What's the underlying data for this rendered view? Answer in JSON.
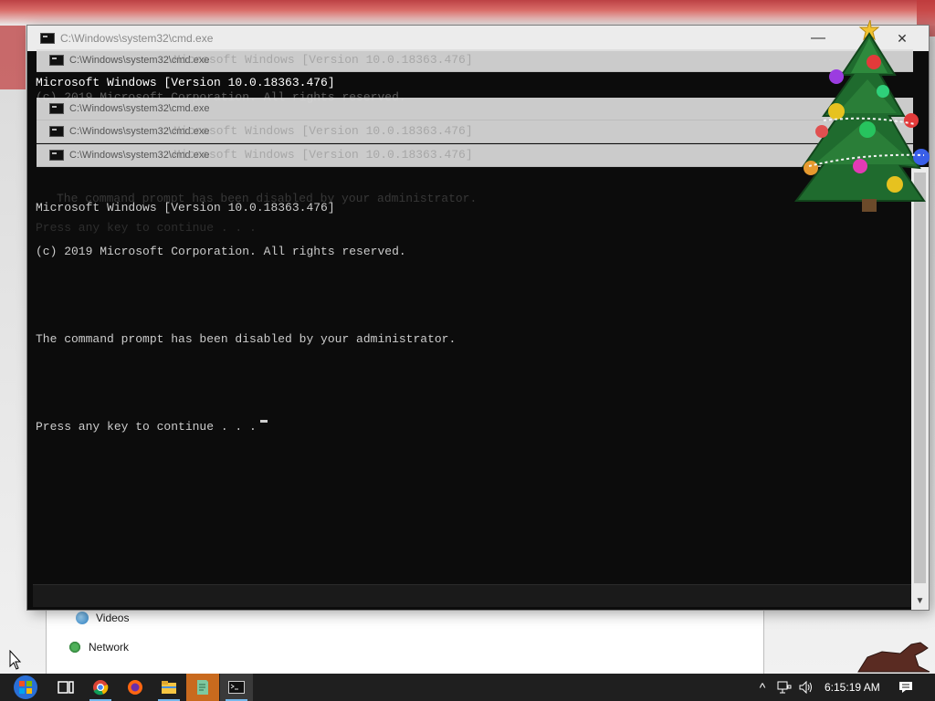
{
  "cmd_window": {
    "title": "C:\\Windows\\system32\\cmd.exe",
    "minimize_label": "—",
    "close_label": "✕",
    "ghost_titles": [
      "C:\\Windows\\system32\\cmd.exe",
      "C:\\Windows\\system32\\cmd.exe",
      "C:\\Windows\\system32\\cmd.exe",
      "C:\\Windows\\system32\\cmd.exe"
    ],
    "ghost_lines": [
      "Microsoft Windows [Version 10.0.18363.476]",
      "(c) 2019 Microsoft Corporation. All rights reserved.",
      "Microsoft Windows [Version 10.0.18363.476]",
      "Microsoft Windows [Version 10.0.18363.476]",
      "(c) 2019 Microsoft Corporation. All rights reserved."
    ],
    "console_lines": [
      "Microsoft Windows [Version 10.0.18363.476]",
      "(c) 2019 Microsoft Corporation. All rights reserved.",
      "",
      "The command prompt has been disabled by your administrator.",
      "",
      "Press any key to continue . . ."
    ],
    "console_top_line": "Microsoft Windows [Version 10.0.18363.476]",
    "console_top_line2": "(c) 2019 Microsoft Corporation. All rights reserved.",
    "faint_line_1": "The command prompt has been disabled by your administrator.",
    "faint_line_2": "Press any key to continue . . ."
  },
  "explorer": {
    "items": [
      "Videos",
      "Network"
    ]
  },
  "taskbar": {
    "clock": "6:15:19 AM",
    "apps": [
      "start-orb",
      "task-view",
      "chrome",
      "firefox",
      "file-explorer",
      "notepad-plus",
      "cmd"
    ]
  },
  "colors": {
    "console_bg": "#0c0c0c",
    "console_text": "#cccccc",
    "taskbar_bg": "#1f1f1f",
    "accent": "#76b9ed"
  }
}
